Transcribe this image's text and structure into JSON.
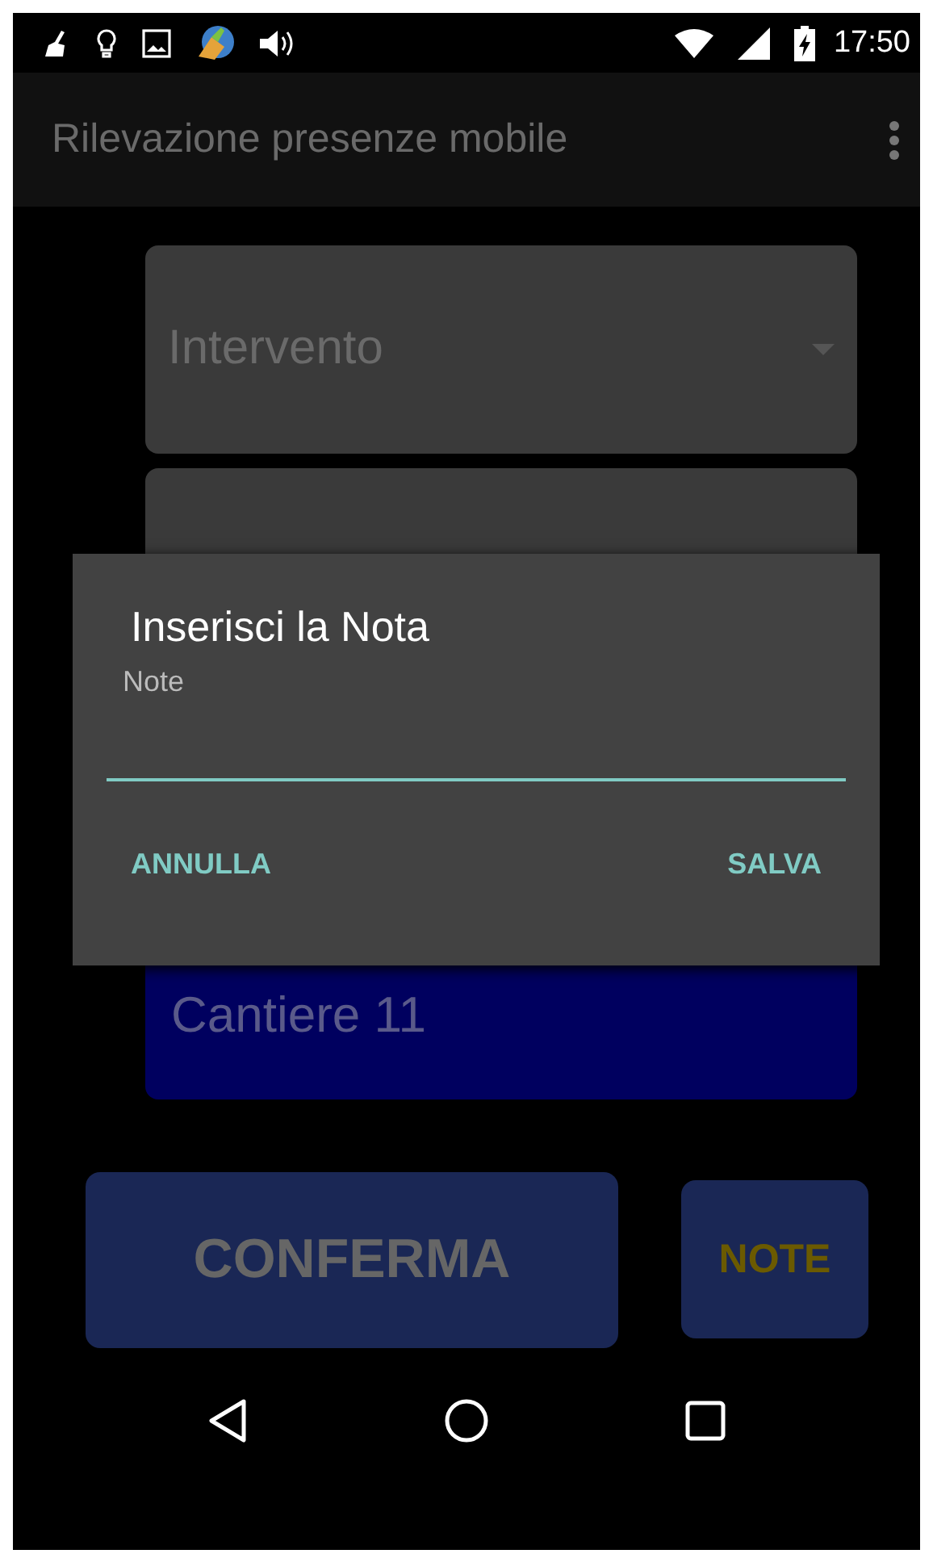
{
  "status_bar": {
    "time": "17:50"
  },
  "app_bar": {
    "title": "Rilevazione presenze mobile"
  },
  "form": {
    "spinner": {
      "placeholder": "Intervento"
    },
    "site": {
      "value": "Cantiere 11"
    }
  },
  "buttons": [
    {
      "label": "CONFERMA",
      "kind": "primary"
    },
    {
      "label": "NOTE",
      "kind": "secondary"
    }
  ],
  "dialog": {
    "title": "Inserisci la Nota",
    "field": {
      "label": "Note",
      "focused": true
    },
    "actions": [
      {
        "label": "ANNULLA"
      },
      {
        "label": "SALVA"
      }
    ]
  }
}
